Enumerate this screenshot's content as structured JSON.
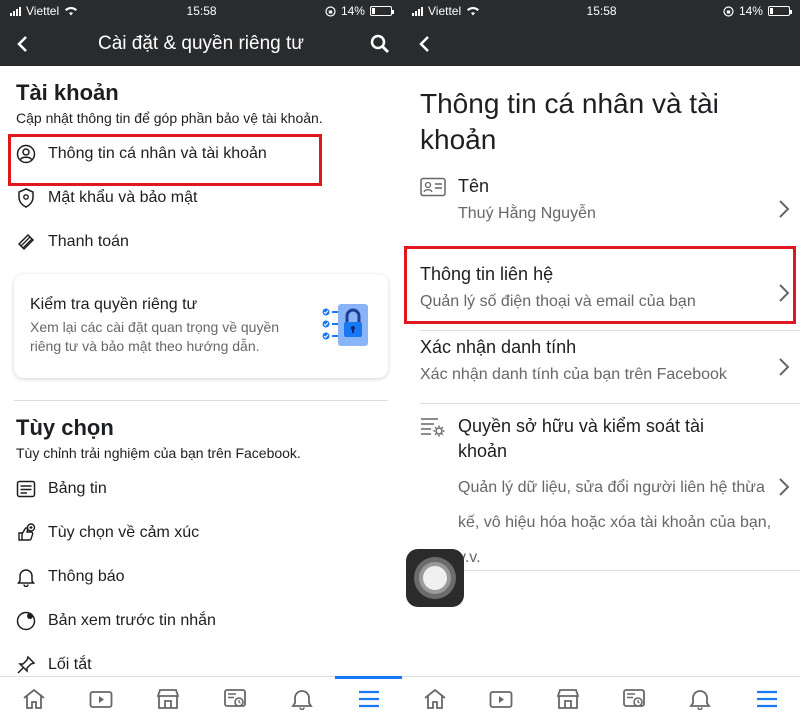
{
  "status": {
    "carrier": "Viettel",
    "time": "15:58",
    "battery": "14%",
    "battery_level": 0.14
  },
  "left": {
    "nav_title": "Cài đặt & quyền riêng tư",
    "account": {
      "title": "Tài khoản",
      "subtitle": "Cập nhật thông tin để góp phần bảo vệ tài khoản.",
      "items": [
        {
          "label": "Thông tin cá nhân và tài khoản",
          "icon": "user-circle-icon"
        },
        {
          "label": "Mật khẩu và bảo mật",
          "icon": "shield-icon"
        },
        {
          "label": "Thanh toán",
          "icon": "tag-icon"
        }
      ]
    },
    "privacy_check": {
      "title": "Kiểm tra quyền riêng tư",
      "description": "Xem lại các cài đặt quan trọng về quyền riêng tư và bảo mật theo hướng dẫn."
    },
    "preferences": {
      "title": "Tùy chọn",
      "subtitle": "Tùy chỉnh trải nghiệm của bạn trên Facebook.",
      "items": [
        {
          "label": "Bảng tin",
          "icon": "news-feed-icon"
        },
        {
          "label": "Tùy chọn về cảm xúc",
          "icon": "reaction-icon"
        },
        {
          "label": "Thông báo",
          "icon": "bell-icon"
        },
        {
          "label": "Bản xem trước tin nhắn",
          "icon": "message-preview-icon"
        },
        {
          "label": "Lối tắt",
          "icon": "pin-icon"
        }
      ]
    }
  },
  "right": {
    "title": "Thông tin cá nhân và tài khoản",
    "rows": [
      {
        "label": "Tên",
        "value": "Thuý Hằng Nguyễn"
      },
      {
        "label": "Thông tin liên hệ",
        "value": "Quản lý số điện thoại và email của bạn"
      },
      {
        "label": "Xác nhận danh tính",
        "value": "Xác nhận danh tính của bạn trên Facebook"
      },
      {
        "label": "Quyền sở hữu và kiểm soát tài khoản",
        "value": "Quản lý dữ liệu, sửa đổi người liên hệ thừa kế, vô hiệu hóa hoặc xóa tài khoản của bạn, v.v."
      }
    ]
  },
  "tabs": [
    "home-icon",
    "watch-icon",
    "marketplace-icon",
    "news-icon",
    "notifications-icon",
    "menu-icon"
  ],
  "colors": {
    "accent": "#1877f2",
    "highlight": "#e0171f",
    "navbar": "#2a2b2d"
  }
}
